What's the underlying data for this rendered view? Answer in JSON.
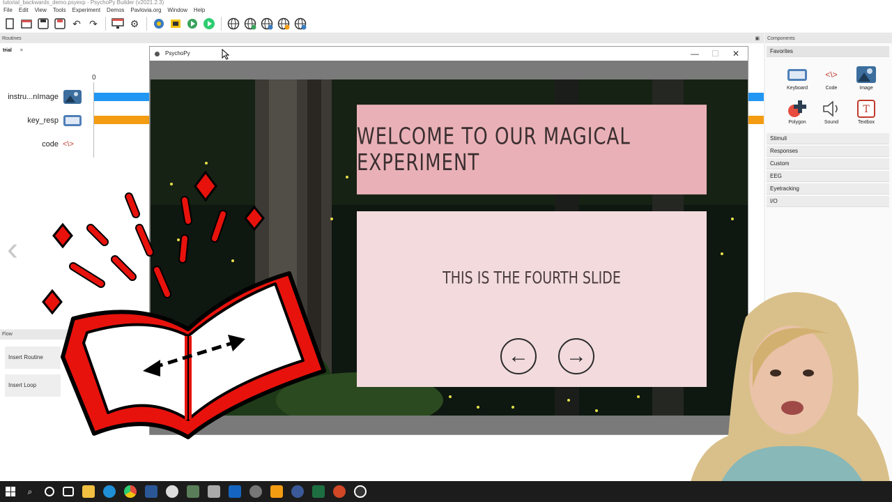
{
  "window": {
    "title": "tutorial_backwards_demo.psyexp - PsychoPy Builder (v2021.2.3)"
  },
  "menu": [
    "File",
    "Edit",
    "View",
    "Tools",
    "Experiment",
    "Demos",
    "Pavlovia.org",
    "Window",
    "Help"
  ],
  "toolbar": {
    "icons": [
      "new-file-icon",
      "open-file-icon",
      "save-icon",
      "save-as-icon",
      "undo-icon",
      "redo-icon",
      "monitor-icon",
      "settings-icon",
      "compile-icon",
      "run-icon",
      "globe-icon"
    ]
  },
  "routines": {
    "header": "Routines",
    "tab_label": "trial",
    "tab_close": "×",
    "time_zero": "0",
    "components": [
      {
        "name": "instru...nImage",
        "icon": "image-icon",
        "color": "#2196f3"
      },
      {
        "name": "key_resp",
        "icon": "keyboard-icon",
        "color": "#f39c12"
      },
      {
        "name": "code",
        "icon": "code-icon",
        "color": ""
      }
    ],
    "prev_arrow": "‹"
  },
  "flow": {
    "header": "Flow",
    "buttons": [
      "Insert Routine",
      "Insert Loop"
    ]
  },
  "components_panel": {
    "header": "Components",
    "favorites_label": "Favorites",
    "favorites": [
      {
        "label": "Keyboard",
        "icon": "keyboard-icon"
      },
      {
        "label": "Code",
        "icon": "code-icon"
      },
      {
        "label": "Image",
        "icon": "image-icon"
      },
      {
        "label": "Polygon",
        "icon": "polygon-icon"
      },
      {
        "label": "Sound",
        "icon": "sound-icon"
      },
      {
        "label": "Textbox",
        "icon": "textbox-icon"
      }
    ],
    "categories": [
      "Stimuli",
      "Responses",
      "Custom",
      "EEG",
      "Eyetracking",
      "I/O"
    ]
  },
  "psychopy_window": {
    "title": "PsychoPy",
    "minimize": "—",
    "maximize": "☐",
    "close": "✕",
    "welcome_text": "WELCOME TO OUR MAGICAL EXPERIMENT",
    "slide_text": "THIS IS THE FOURTH SLIDE",
    "back_arrow": "←",
    "forward_arrow": "→"
  },
  "colors": {
    "welcome_bg": "#e9b1b7",
    "slide_bg": "#f2dadd",
    "book_red": "#e8120c",
    "timeline_blue": "#2196f3",
    "timeline_orange": "#f39c12"
  },
  "taskbar": {
    "icons": [
      "windows-start-icon",
      "search-icon",
      "cortana-icon",
      "task-view-icon",
      "file-explorer-icon",
      "edge-icon",
      "chrome-icon",
      "word-icon",
      "paint-icon",
      "photos-icon",
      "app-icon",
      "psychopy-taskbar-icon",
      "sublime-icon",
      "firefox-icon",
      "excel-icon",
      "powerpoint-icon",
      "obs-icon"
    ]
  }
}
